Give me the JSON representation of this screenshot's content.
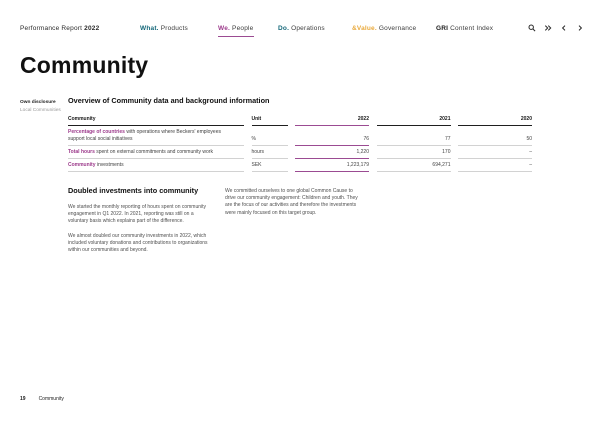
{
  "nav": {
    "brand": {
      "prefix": "Performance Report ",
      "year": "2022"
    },
    "items": [
      {
        "prefix": "What.",
        "label": "Products",
        "color": "#15687a",
        "active": false
      },
      {
        "prefix": "We.",
        "label": "People",
        "color": "#9c3a8b",
        "active": true
      },
      {
        "prefix": "Do.",
        "label": "Operations",
        "color": "#15687a",
        "active": false
      },
      {
        "prefix": "&Value.",
        "label": "Governance",
        "color": "#e9a93b",
        "active": false
      },
      {
        "prefix": "GRI",
        "label": "Content Index",
        "color": "#1a1a1a",
        "active": false
      }
    ],
    "icons": [
      "search",
      "double-chevron-right",
      "chevron-left",
      "chevron-right"
    ]
  },
  "page": {
    "title": "Community",
    "disclosure_note": {
      "title": "Own disclosure",
      "subtitle": "Local Communities"
    },
    "footer": {
      "page_number": "19",
      "section": "Community"
    }
  },
  "overview": {
    "section_title": "Overview of Community data and background information",
    "accent_color": "#9b4b92",
    "table": {
      "headers": [
        "Community",
        "Unit",
        "2022",
        "2021",
        "2020"
      ],
      "rows": [
        {
          "label_bold": "Percentage of countries",
          "label_rest": " with operations where Beckers' employees support local social initiatives",
          "unit": "%",
          "v2022": "76",
          "v2021": "77",
          "v2020": "50"
        },
        {
          "label_bold": "Total hours",
          "label_rest": " spent on external commitments and community work",
          "unit": "hours",
          "v2022": "1,220",
          "v2021": "170",
          "v2020": "–"
        },
        {
          "label_bold": "Community",
          "label_rest": " investments",
          "unit": "SEK",
          "v2022": "1,223,179",
          "v2021": "694,271",
          "v2020": "–"
        }
      ]
    }
  },
  "article": {
    "heading": "Doubled investments into community",
    "left_paragraphs": [
      "We started the monthly reporting of hours spent on community engagement in Q1 2022. In 2021, reporting was still on a voluntary basis which explains part of the difference.",
      "We almost doubled our community investments in 2022, which included voluntary donations and contributions to organizations within our communities and beyond."
    ],
    "right_paragraphs": [
      "We committed ourselves to one global Common Cause to drive our community engagement: Children and youth. They are the focus of our activities and therefore the investments were mainly focused on this target group."
    ]
  }
}
